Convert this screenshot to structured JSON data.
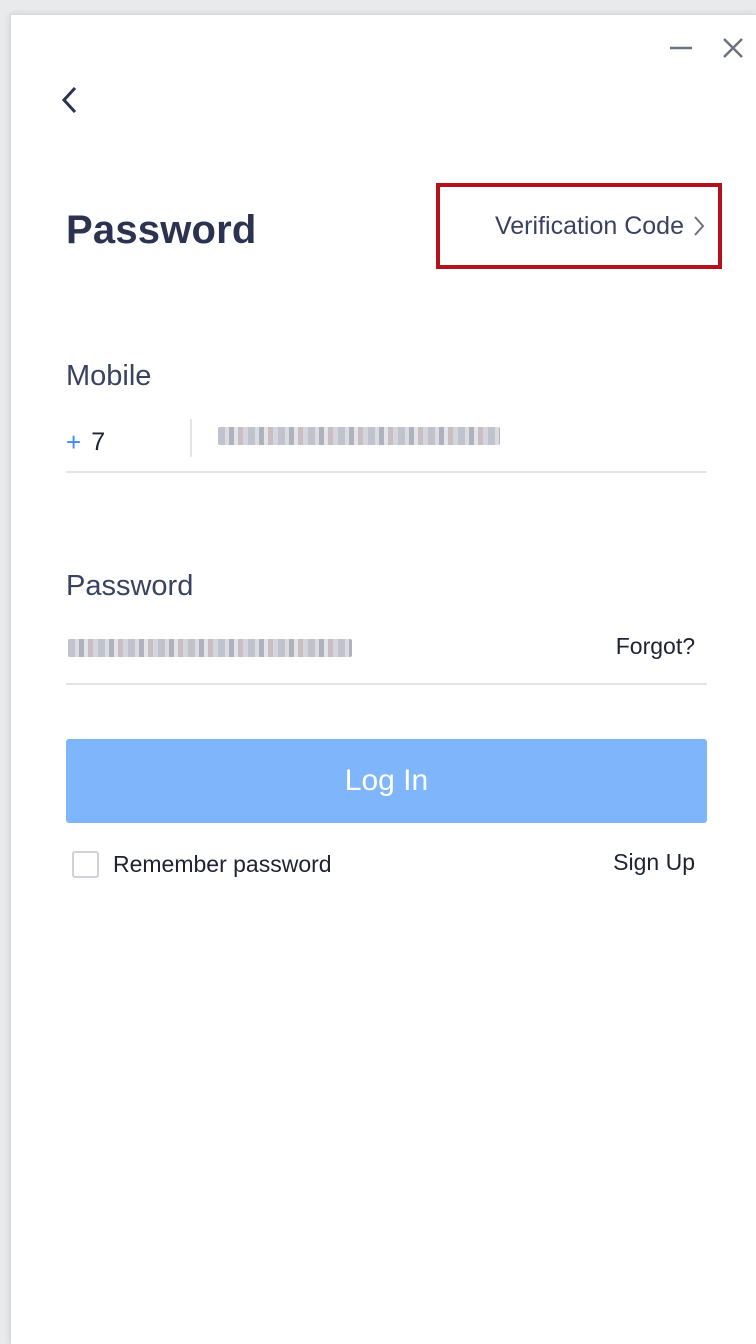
{
  "window": {
    "minimize_icon": "minimize-icon",
    "close_icon": "close-icon"
  },
  "header": {
    "back_icon": "chevron-left-icon",
    "title": "Password",
    "mode_switch_label": "Verification Code",
    "mode_switch_icon": "chevron-right-icon"
  },
  "mobile": {
    "label": "Mobile",
    "country_plus": "+",
    "country_code": "7",
    "value_obscured": true
  },
  "password": {
    "label": "Password",
    "value_obscured": true,
    "forgot_label": "Forgot?"
  },
  "actions": {
    "login_label": "Log In",
    "remember_label": "Remember password",
    "remember_checked": false,
    "signup_label": "Sign Up"
  },
  "colors": {
    "accent_blue": "#3b8df0",
    "login_button": "#7fb6fb",
    "highlight_box": "#b5101b",
    "title_text": "#2b3350"
  }
}
